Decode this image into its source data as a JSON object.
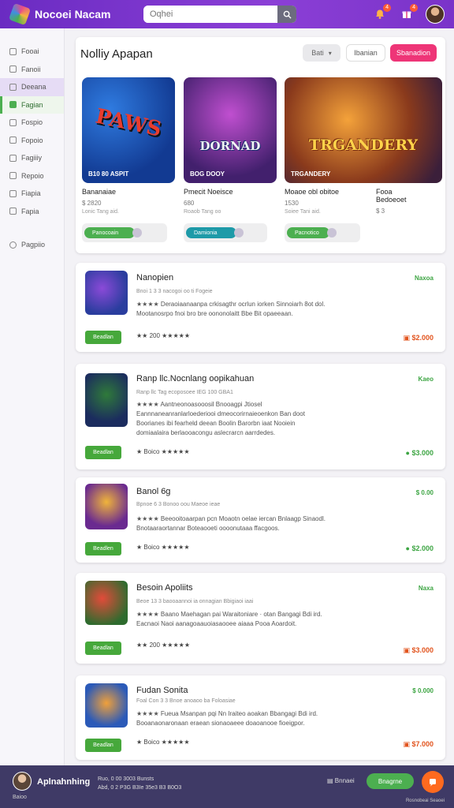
{
  "header": {
    "title": "Nocoei Nacam",
    "search_placeholder": "Oqhei",
    "bell_badge": "4",
    "gift_badge": "4"
  },
  "sidebar": {
    "items": [
      {
        "label": "Fooai",
        "icon": "home-icon"
      },
      {
        "label": "Fanoii",
        "icon": "grid-icon"
      },
      {
        "label": "Deeana",
        "icon": "star-icon",
        "state": "selected"
      },
      {
        "label": "Fagian",
        "icon": "check-icon",
        "state": "active"
      },
      {
        "label": "Fospio",
        "icon": "clock-icon"
      },
      {
        "label": "Fopoio",
        "icon": "list-icon"
      },
      {
        "label": "Fagiiiy",
        "icon": "tag-icon"
      },
      {
        "label": "Repoio",
        "icon": "chart-icon"
      },
      {
        "label": "Fiapia",
        "icon": "user-icon"
      },
      {
        "label": "Fapia",
        "icon": "gear-icon"
      },
      {
        "label": "Pagpiio",
        "icon": "help-icon"
      }
    ]
  },
  "featured": {
    "title": "Nolliy Apapan",
    "filter_label": "Bati",
    "secondary_label": "Ibanian",
    "primary_label": "Sbanadion",
    "cards": [
      {
        "art_text": "PAWS",
        "caption": "B10 80 ASPIT",
        "name": "Bananaiae",
        "meta": "$ 2820",
        "sub": "Lonic Tang aid.",
        "action": "Panocoain",
        "accent": "#4caf50"
      },
      {
        "art_text": "DORNAD",
        "caption": "BOG DOOY",
        "name": "Pmecit Noeisce",
        "meta": "680",
        "sub": "Roaob Tang oo",
        "action": "Damionia",
        "accent": "#1e9aa8"
      },
      {
        "art_text": "TRGANDERY",
        "caption": "TRGANDERY",
        "name": "Moaoe obl obitoe",
        "meta": "1530",
        "sub": "Soiee Tani aid.",
        "action": "Pacnotico",
        "accent": "#4caf50"
      }
    ],
    "card_side": [
      {
        "name": "Fooa Bedoeoet",
        "meta": "$ 3"
      }
    ]
  },
  "list": [
    {
      "title": "Nanopien",
      "category": "Naxoa",
      "meta": "Bnoi 1 3 3 nacogoi oo ti Fogeie",
      "desc": [
        "★★★★ Deraoiaanaanpa crkisagthr ocrlun iorken Sinnoiarh 8ot dol.",
        "Mootanosrpo fnoi bro bre oononolaitt Bbe Bit opaeeaan."
      ],
      "button": "Beadlan",
      "rating_label": "★★ 200 ★★★★★",
      "price": "$2.000",
      "price_icon": "cart-icon",
      "price_color": "red"
    },
    {
      "title": "Ranp llc.Nocnlang oopikahuan",
      "category": "Kaeo",
      "meta": "Ranp llc Tag ecoposoee      IEG 100 GBA1",
      "desc": [
        "★★★★ Aantneonoasooosil                       Bnooagpi Jtiosel",
        "Eannnaneanranlarloederiooi dmeocorirnaieoenkon Ban doot",
        "Boorianes ibi fearheld deean Boolin Barorbn iaat Nooiein",
        "domiaalaira berlaooacongu aslecrarcn aarrdedes."
      ],
      "button": "Beadlan",
      "rating_label": "★ Boico ★★★★★",
      "price": "$3.000",
      "price_icon": "dollar-icon",
      "price_color": "green"
    },
    {
      "title": "Banol 6g",
      "category": "$ 0.00",
      "meta": "Bpnoe 6 3 Bonoo oou Maeoe ieae",
      "desc": [
        "★★★★ Beeooitoaarpan pcn Moaotn oelae iercan Bnlaagp Sinaodl.",
        "Bnotaaraortannar Boteaooeti oooonutaaa ffacgoos."
      ],
      "button": "Beadlen",
      "rating_label": "★ Boico ★★★★★",
      "price": "$2.000",
      "price_icon": "dollar-icon",
      "price_color": "green"
    },
    {
      "title": "Besoin Apoliits",
      "category": "Naxa",
      "meta": "Beoe 13 3 baooaannoi ia onnagian        Bbigiaoi iaai",
      "desc": [
        "★★★★ Baano Maehagan pai Waraitoniare · otan Bangagi Bdi ird.",
        "Eacnaoi Naoi aanagoaauoiasaooee aiaaa Pooa Aoardoit."
      ],
      "button": "Beadlan",
      "rating_label": "★★ 200 ★★★★★",
      "price": "$3.000",
      "price_icon": "cart-icon",
      "price_color": "red"
    },
    {
      "title": "Fudan Sonita",
      "category": "$ 0.000",
      "meta": "Foal Con 3 3 Bnoe anoaoo ba Foloasiae",
      "desc": [
        "★★★★ Fueua Msanpan pqi Nn Iraiteo aoakan Bbangagi Bdi ird.",
        "Booanaonaronaan eraean sionaoaeee doaoanooe fioeigpor."
      ],
      "button": "Beadlan",
      "rating_label": "★ Boico ★★★★★",
      "price": "$7.000",
      "price_icon": "cart-icon",
      "price_color": "red"
    }
  ],
  "footer": {
    "user": "Aplnahnhing",
    "user_sub": "Baioo",
    "info_line1": "Ruo, 0 00 3003  Bunsts",
    "info_line2": "Abd, 0 2 P3G B3Ie 35e3 B3 B0O3",
    "link_label": "Bnnaei",
    "primary_label": "Bnagrne",
    "corner": "Rosnobeai Seaoei"
  },
  "colors": {
    "header": "#7a33c9",
    "accent_pink": "#ee3577",
    "accent_green": "#46a83b",
    "footer": "#3f3a66",
    "price_red": "#e2541e"
  }
}
